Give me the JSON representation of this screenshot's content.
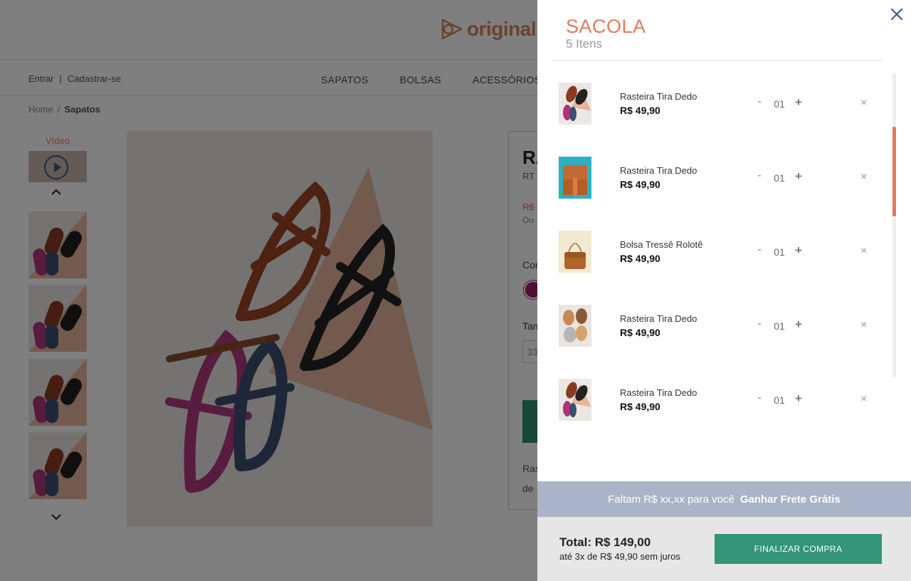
{
  "header": {
    "logo_text": "original.io"
  },
  "navbar": {
    "login": "Entrar",
    "separator": "|",
    "register": "Cadastrar-se",
    "links": [
      "SAPATOS",
      "BOLSAS",
      "ACESSÓRIOS"
    ]
  },
  "breadcrumb": {
    "home": "Home",
    "separator": "/",
    "current": "Sapatos"
  },
  "gallery": {
    "video_label": "Vídeo"
  },
  "product": {
    "title_partial": "RA",
    "sku_partial": "RT",
    "old_price_partial": "R$",
    "installment_partial": "Ou",
    "color_label_partial": "Cor",
    "size_label_partial": "Tam",
    "size_value_partial": "33",
    "desc_line1_partial": "Ras",
    "desc_line2_partial": "de"
  },
  "cart": {
    "title": "SACOLA",
    "count": "5 Itens",
    "items": [
      {
        "name": "Rasteira Tira Dedo",
        "price": "R$ 49,90",
        "qty": "01",
        "minus": "-",
        "plus": "+",
        "remove": "×"
      },
      {
        "name": "Rasteira Tira Dedo",
        "price": "R$ 49,90",
        "qty": "01",
        "minus": "-",
        "plus": "+",
        "remove": "×"
      },
      {
        "name": "Bolsa Tressê Rolotê",
        "price": "R$ 49,90",
        "qty": "01",
        "minus": "-",
        "plus": "+",
        "remove": "×"
      },
      {
        "name": "Rasteira Tira Dedo",
        "price": "R$ 49,90",
        "qty": "01",
        "minus": "-",
        "plus": "+",
        "remove": "×"
      },
      {
        "name": "Rasteira Tira Dedo",
        "price": "R$ 49,90",
        "qty": "01",
        "minus": "-",
        "plus": "+",
        "remove": "×"
      }
    ],
    "shipping_prefix": "Faltam R$ xx,xx para você",
    "shipping_highlight": "Ganhar Frete Grátis",
    "total": "Total: R$ 149,00",
    "installments": "até 3x de R$ 49,90 sem juros",
    "checkout_label": "FINALIZAR COMPRA"
  },
  "icons": {
    "close": "close-icon",
    "play": "play-icon",
    "chevron_up": "chevron-up-icon",
    "chevron_down": "chevron-down-icon"
  },
  "colors": {
    "accent": "#e07a5f",
    "checkout": "#339478",
    "shipping_bar": "#a9b4c6",
    "close_icon": "#3a5a8c"
  }
}
